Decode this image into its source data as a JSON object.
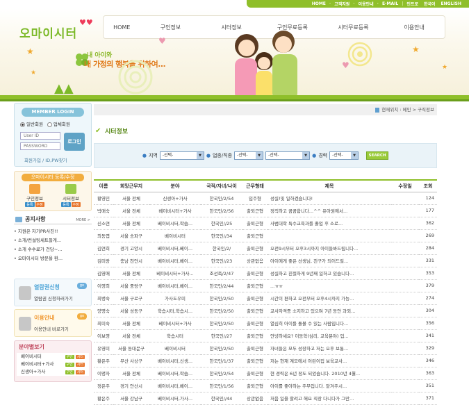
{
  "topnav": [
    "HOME",
    "고객지원",
    "이용안내",
    "E-MAIL",
    "인트로",
    "한국어",
    "ENGLISH"
  ],
  "logo": "오마이시터",
  "nav": [
    "HOME",
    "구인정보",
    "시터정보",
    "구인무료등록",
    "시터무료등록",
    "이용안내"
  ],
  "slogan": {
    "line1": "내 아이와",
    "line2": "내 가정의 행복을 위하여..."
  },
  "login": {
    "title": "MEMBER LOGIN",
    "radio1": "일반회원",
    "radio2": "업체회원",
    "id_placeholder": "User ID",
    "pw_placeholder": "PASSWORD",
    "button": "로그인",
    "links": "회원가입 / ID,PW찾기"
  },
  "register": {
    "title": "오마이시터 등록/수정",
    "box1": "구인정보",
    "box2": "시터정보",
    "tag_reg": "등록",
    "tag_edit": "수정"
  },
  "notice": {
    "title": "공지사항",
    "more": "MORE >",
    "items": [
      "지원은 자기PR사진!!",
      "소개/컨설팅세트들게...",
      "소개 수수료가 건당~...",
      "오마이시터 방문을 환..."
    ]
  },
  "banner1": {
    "title": "열람권신청",
    "text": "열람권 신청하러가기",
    "go": "go"
  },
  "banner2": {
    "title": "이용안내",
    "text": "이용안내 바로가기",
    "go": "go"
  },
  "category": {
    "title": "분야별보기",
    "rows": [
      "베이비시터",
      "베이비시터+가사",
      "신생아+가사"
    ],
    "tag1": "구인",
    "tag2": "시터"
  },
  "location": "현재위치 : 메인 > 구직정보",
  "page_title": "시터정보",
  "search": {
    "area_label": "지역",
    "area_value": "-선택-",
    "job_label": "업종/직종",
    "job_value1": "-선택-",
    "job_value2": "-선택-",
    "career_label": "경력",
    "career_value": "-선택-",
    "button": "SEARCH"
  },
  "table": {
    "headers": [
      "이름",
      "희망근무지",
      "분야",
      "국적/자녀/나이",
      "근무형태",
      "제목",
      "수정일",
      "조회"
    ],
    "rows": [
      [
        "황영민",
        "서울 전체",
        "신생아+가사",
        "한국인/2/54",
        "입주형",
        "성실!및 일하겠습니다!",
        "",
        "124"
      ],
      [
        "박매숙",
        "서울 전체",
        "베이비시터+가사",
        "한국인/2/56",
        "출퇴근형",
        "정직하고 꼼꼼합니다...^^ 유아원에서...",
        "",
        "177"
      ],
      [
        "신소연",
        "서울 전체",
        "베이비시터,학습...",
        "한국인//25",
        "출퇴근형",
        "사범대학 특수교육과를 졸업 후 소로...",
        "",
        "362"
      ],
      [
        "최동엽",
        "서울 송파구",
        "베이비시터",
        "한국인//34",
        "출퇴근형",
        "",
        "",
        "269"
      ],
      [
        "김연희",
        "경기 고양시",
        "베이비시터,베이...",
        "한국인/2/",
        "출퇴근형",
        "오전9시부터 오후3시까지 아이들봐드립니다...",
        "",
        "284"
      ],
      [
        "김미랑",
        "충남 천안시",
        "베이비시터,베이...",
        "한국인//23",
        "상관없음",
        "아이에게 좋은 선생님, 친구가 되어드릴...",
        "",
        "331"
      ],
      [
        "김영애",
        "서울 전체",
        "베이비시터+가사...",
        "조선족/2/47",
        "출퇴근형",
        "성실하고 친절하게 9년째 일하고 있습니다...",
        "",
        "353"
      ],
      [
        "이영희",
        "서울 중랑구",
        "베이비시터,베이...",
        "한국인/2/44",
        "출퇴근형",
        "...ㅠㅠ",
        "",
        "379"
      ],
      [
        "최병숙",
        "서울 구로구",
        "가사도우미",
        "한국인/2/50",
        "출퇴근형",
        "시간이 편하고 오전부터 오후4시까지 가능...",
        "",
        "274"
      ],
      [
        "양명숙",
        "서울 성동구",
        "학습시터,학습시...",
        "한국인/2/50",
        "출퇴근형",
        "교사자격증 소지하고 있으며 7년 동안 과외...",
        "",
        "304"
      ],
      [
        "최미숙",
        "서울 전체",
        "베이비시터+가사",
        "한국인/2/50",
        "출퇴근형",
        "열심히 아이를 돌볼 수 있는 사람입니다...",
        "",
        "356"
      ],
      [
        "이보영",
        "서울 전체",
        "학습시터",
        "한국인//27",
        "출퇴근형",
        "안녕하세요? 이동학(심리, 교육분야) 입...",
        "",
        "341"
      ],
      [
        "유영미",
        "서울 동대문구",
        "베이비시터",
        "한국인/2/50",
        "출퇴근형",
        "자녀들은 모두 성장하고 저는 오후 보통...",
        "",
        "329"
      ],
      [
        "황은주",
        "부산 사상구",
        "베이비시터,신생...",
        "한국인/1/37",
        "출퇴근형",
        "저는 현재 계모에서 어린이집 보육교사...",
        "",
        "346"
      ],
      [
        "이명자",
        "서울 전체",
        "베이비시터,학습...",
        "한국인/2/54",
        "출퇴근형",
        "현 경력은 6년 정도 되었습니다. 2010년 4월...",
        "",
        "363"
      ],
      [
        "정은주",
        "경기 안산시",
        "베이비시터,베이...",
        "한국인/1/56",
        "출퇴근형",
        "아이를 좋아하는 주부입니다. 맡겨주시...",
        "",
        "351"
      ],
      [
        "황은주",
        "서울 강남구",
        "베이비시터,가사...",
        "한국인//44",
        "상관없음",
        "처음 일을 할려고 해요 직장 다니다가 그만...",
        "",
        "371"
      ]
    ]
  }
}
